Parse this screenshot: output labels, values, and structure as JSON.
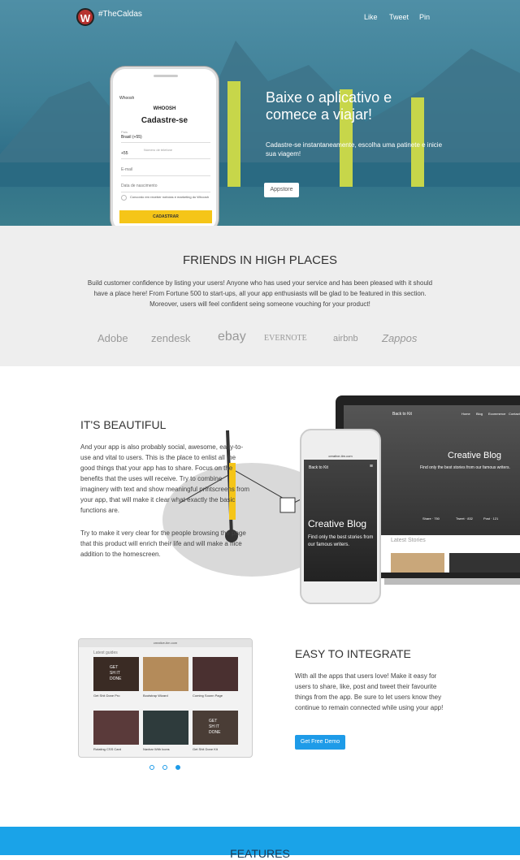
{
  "header": {
    "brand": "#TheCaldas",
    "logo_letter": "W",
    "nav": [
      "Like",
      "Tweet",
      "Pin"
    ]
  },
  "hero": {
    "title": "Baixe o aplicativo e comece a viajar!",
    "subtitle": "Cadastre-se instantaneamente, escolha uma patinete e inicie sua viagem!",
    "cta": "Appstore"
  },
  "phone": {
    "carrier": "Whoosh",
    "app_name": "WHOOSH",
    "screen_title": "Cadastre-se",
    "country_label": "País",
    "country_value": "Brasil (+55)",
    "phone_label": "Número de telefone",
    "phone_prefix": "+55",
    "email_label": "E-mail",
    "dob_label": "Data de nascimento",
    "consent": "Concordo em receber notícias e marketing do Whoosh",
    "submit": "CADASTRAR"
  },
  "friends": {
    "title": "FRIENDS IN HIGH PLACES",
    "text": "Build customer confidence by listing your users! Anyone who has used your service and has been pleased with it should have a place here! From Fortune 500 to start-ups, all your app enthusiasts will be glad to be featured in this section. Moreover, users will feel confident seing someone vouching for your product!",
    "logos": [
      "Adobe",
      "zendesk",
      "ebay",
      "EVERNOTE",
      "airbnb",
      "Zappos"
    ]
  },
  "beautiful": {
    "title": "IT'S BEAUTIFUL",
    "p1": "And your app is also probably social, awesome, easy-to-use and vital to users. This is the place to enlist all the good things that your app has to share. Focus on the benefits that the uses will receive. Try to combine imaginery with text and show meaningful printscreens from your app, that will make it clear what exactly the basic functions are.",
    "p2": "Try to make it very clear for the people browsing the page that this product will enrich their life and will make a nice addition to the homescreen."
  },
  "laptop": {
    "back": "Back to Kit",
    "nav": [
      "Home",
      "Blog",
      "Ecommerce",
      "Contact"
    ],
    "blog_title": "Creative Blog",
    "blog_sub": "Find only the best stories from our famous writers.",
    "shares": [
      "Share · 750",
      "Tweet · 832",
      "Post · 121"
    ],
    "latest": "Latest Stories"
  },
  "phone2": {
    "url": "creative-tim.com",
    "back": "Back to Kit",
    "blog_title": "Creative Blog",
    "blog_sub": "Find only the best stories from our famous writers."
  },
  "browser": {
    "url": "creative-tim.com",
    "heading": "Latest guides",
    "cards": [
      "Get Shit Done Pro",
      "Bootstrap Wizard",
      "Coming Soonn Page",
      "Rotating CSS Card",
      "Navbar With Icons",
      "Get Shit Done Kit"
    ],
    "tile_text": "GET SH IT DONE"
  },
  "integrate": {
    "title": "EASY TO INTEGRATE",
    "text": "With all the apps that users love! Make it easy for users to share, like, post and tweet their favourite things from the app. Be sure to let users know they continue to remain connected while using your app!",
    "cta": "Get Free Demo"
  },
  "features": {
    "title": "FEATURES"
  },
  "colors": {
    "accent": "#1e9be8",
    "features_bg": "#1aa3e8",
    "hero_bg": "#3e7f96",
    "logo_bg": "#b6322f"
  }
}
